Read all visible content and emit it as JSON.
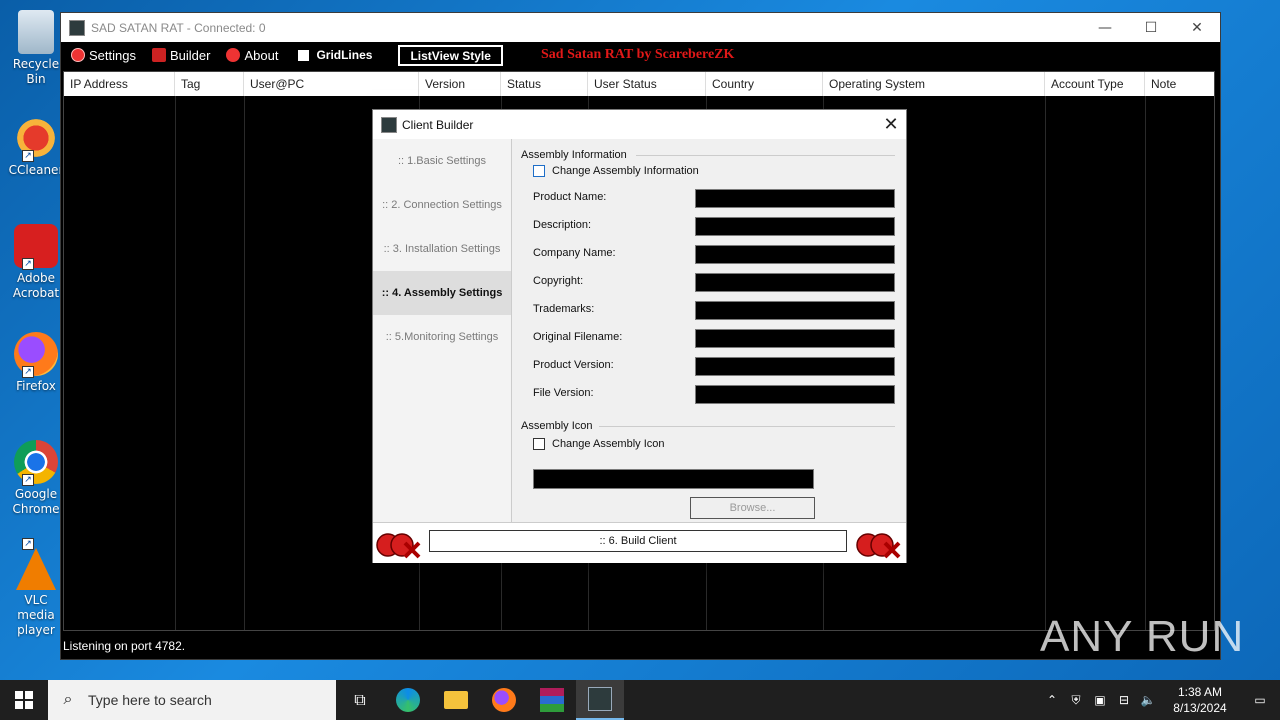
{
  "desktop": {
    "icons": [
      {
        "label": "Recycle Bin",
        "icon": "recycle-bin-icon"
      },
      {
        "label": "CCleaner",
        "icon": "ccleaner-icon"
      },
      {
        "label": "Adobe Acrobat",
        "icon": "adobe-acrobat-icon"
      },
      {
        "label": "Firefox",
        "icon": "firefox-icon"
      },
      {
        "label": "Google Chrome",
        "icon": "chrome-icon"
      },
      {
        "label": "VLC media player",
        "icon": "vlc-icon"
      }
    ]
  },
  "main_window": {
    "title": "SAD SATAN RAT - Connected: 0",
    "menu": {
      "settings": "Settings",
      "builder": "Builder",
      "about": "About",
      "gridlines": "GridLines",
      "listview_style": "ListView Style"
    },
    "brand": "Sad Satan RAT by ScarebereZK",
    "columns": [
      "IP Address",
      "Tag",
      "User@PC",
      "Version",
      "Status",
      "User Status",
      "Country",
      "Operating System",
      "Account Type",
      "Note"
    ],
    "status": "Listening on port 4782."
  },
  "dialog": {
    "title": "Client Builder",
    "nav": [
      ":: 1.Basic Settings",
      ":: 2. Connection Settings",
      ":: 3. Installation Settings",
      ":: 4. Assembly Settings",
      ":: 5.Monitoring Settings"
    ],
    "active_nav": 3,
    "assembly_info_label": "Assembly Information",
    "change_info_label": "Change Assembly Information",
    "fields": [
      "Product Name:",
      "Description:",
      "Company Name:",
      "Copyright:",
      "Trademarks:",
      "Original Filename:",
      "Product Version:",
      "File Version:"
    ],
    "assembly_icon_label": "Assembly Icon",
    "change_icon_label": "Change Assembly Icon",
    "browse_label": "Browse...",
    "build_label": ":: 6. Build Client"
  },
  "taskbar": {
    "search_placeholder": "Type here to search",
    "time": "1:38 AM",
    "date": "8/13/2024"
  },
  "watermark": "ANY RUN"
}
